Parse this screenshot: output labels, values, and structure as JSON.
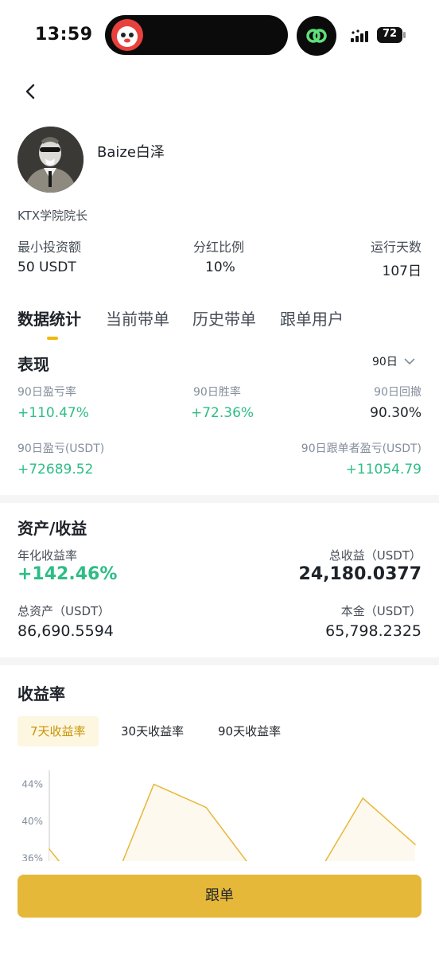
{
  "status_bar": {
    "time": "13:59",
    "battery": "72"
  },
  "profile": {
    "name": "Baize白泽",
    "bio": "KTX学院院长",
    "stats": [
      {
        "label": "最小投资额",
        "value": "50 USDT"
      },
      {
        "label": "分红比例",
        "value": "10%"
      },
      {
        "label": "运行天数",
        "value": "107日"
      }
    ]
  },
  "tabs": [
    "数据统计",
    "当前带单",
    "历史带单",
    "跟单用户"
  ],
  "performance": {
    "title": "表现",
    "period": "90日",
    "metrics": [
      {
        "label": "90日盈亏率",
        "value": "+110.47%"
      },
      {
        "label": "90日胜率",
        "value": "+72.36%"
      },
      {
        "label": "90日回撤",
        "value": "90.30%"
      },
      {
        "label": "90日盈亏(USDT)",
        "value": "+72689.52"
      },
      {
        "label": "90日跟单者盈亏(USDT)",
        "value": "+11054.79"
      }
    ]
  },
  "assets": {
    "title": "资产/收益",
    "annual_label": "年化收益率",
    "annual_value": "+142.46%",
    "total_profit_label": "总收益（USDT）",
    "total_profit_value": "24,180.0377",
    "total_assets_label": "总资产（USDT）",
    "total_assets_value": "86,690.5594",
    "principal_label": "本金（USDT）",
    "principal_value": "65,798.2325"
  },
  "returns": {
    "title": "收益率",
    "chips": [
      "7天收益率",
      "30天收益率",
      "90天收益率"
    ],
    "active_chip": 0
  },
  "chart_data": {
    "type": "area",
    "y_ticks": [
      "44%",
      "40%",
      "36%"
    ],
    "series": [
      {
        "values": [
          37,
          30,
          44,
          41.5,
          34,
          33,
          42.5,
          37.5
        ]
      }
    ],
    "ylim": [
      34.5,
      45.5
    ],
    "color": "#e6b83a"
  },
  "follow_button": "跟单",
  "colors": {
    "accent": "#f0b90b",
    "green": "#2ebd85",
    "button": "#e6b83a"
  },
  "icons": [
    "back-arrow-icon",
    "chevron-down-icon",
    "link-icon",
    "signal-icon",
    "battery-icon"
  ]
}
